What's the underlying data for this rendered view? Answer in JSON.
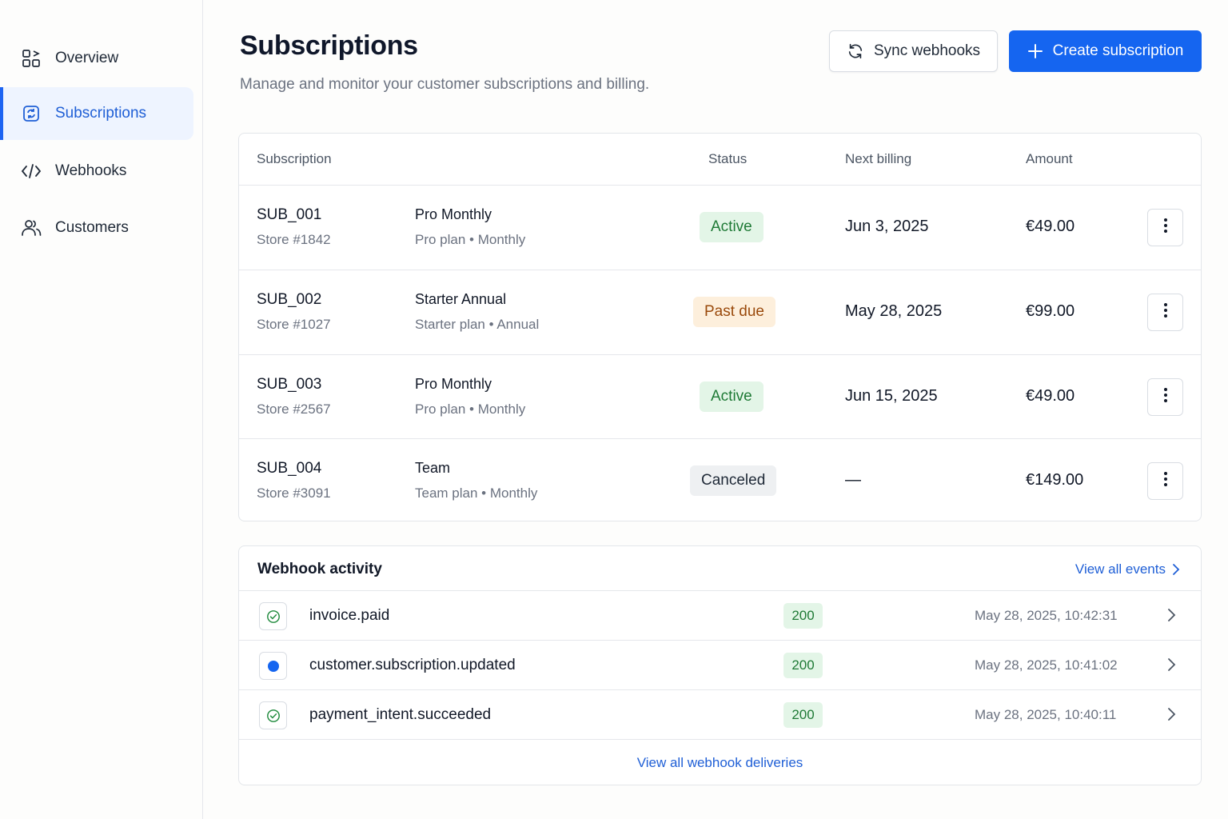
{
  "sidebar": {
    "items": [
      {
        "label": "Overview",
        "icon": "overview-grid-icon"
      },
      {
        "label": "Subscriptions",
        "icon": "subscriptions-icon",
        "active": true
      },
      {
        "label": "Webhooks",
        "icon": "code-icon"
      },
      {
        "label": "Customers",
        "icon": "users-icon"
      }
    ]
  },
  "header": {
    "title": "Subscriptions",
    "subtitle": "Manage and monitor your customer subscriptions and billing.",
    "sync_label": "Sync webhooks",
    "create_label": "Create subscription"
  },
  "table": {
    "columns": {
      "subscription": "Subscription",
      "status": "Status",
      "next_billing": "Next billing",
      "amount": "Amount"
    },
    "rows": [
      {
        "id": "SUB_001",
        "store": "Store #1842",
        "plan": "Pro Monthly",
        "plan_desc": "Pro plan • Monthly",
        "status": "Active",
        "status_type": "active",
        "next_billing": "Jun 3, 2025",
        "amount": "€49.00"
      },
      {
        "id": "SUB_002",
        "store": "Store #1027",
        "plan": "Starter Annual",
        "plan_desc": "Starter plan • Annual",
        "status": "Past due",
        "status_type": "pastdue",
        "next_billing": "May 28, 2025",
        "amount": "€99.00"
      },
      {
        "id": "SUB_003",
        "store": "Store #2567",
        "plan": "Pro Monthly",
        "plan_desc": "Pro plan • Monthly",
        "status": "Active",
        "status_type": "active",
        "next_billing": "Jun 15, 2025",
        "amount": "€49.00"
      },
      {
        "id": "SUB_004",
        "store": "Store #3091",
        "plan": "Team",
        "plan_desc": "Team plan • Monthly",
        "status": "Canceled",
        "status_type": "canceled",
        "next_billing": "—",
        "amount": "€149.00"
      }
    ]
  },
  "webhooks": {
    "title": "Webhook activity",
    "view_all_events": "View all events",
    "events": [
      {
        "event": "invoice.paid",
        "code": "200",
        "time": "May 28, 2025, 10:42:31",
        "status_icon": "check-circle-icon"
      },
      {
        "event": "customer.subscription.updated",
        "code": "200",
        "time": "May 28, 2025, 10:41:02",
        "status_icon": "blue-dot-icon"
      },
      {
        "event": "payment_intent.succeeded",
        "code": "200",
        "time": "May 28, 2025, 10:40:11",
        "status_icon": "check-circle-icon"
      }
    ],
    "footer_link": "View all webhook deliveries"
  },
  "colors": {
    "accent": "#1565f0",
    "active_bg": "#e3f5e7",
    "active_fg": "#1f7a36",
    "pastdue_bg": "#fdefdc",
    "pastdue_fg": "#9a4a0c",
    "canceled_bg": "#eef0f2"
  }
}
